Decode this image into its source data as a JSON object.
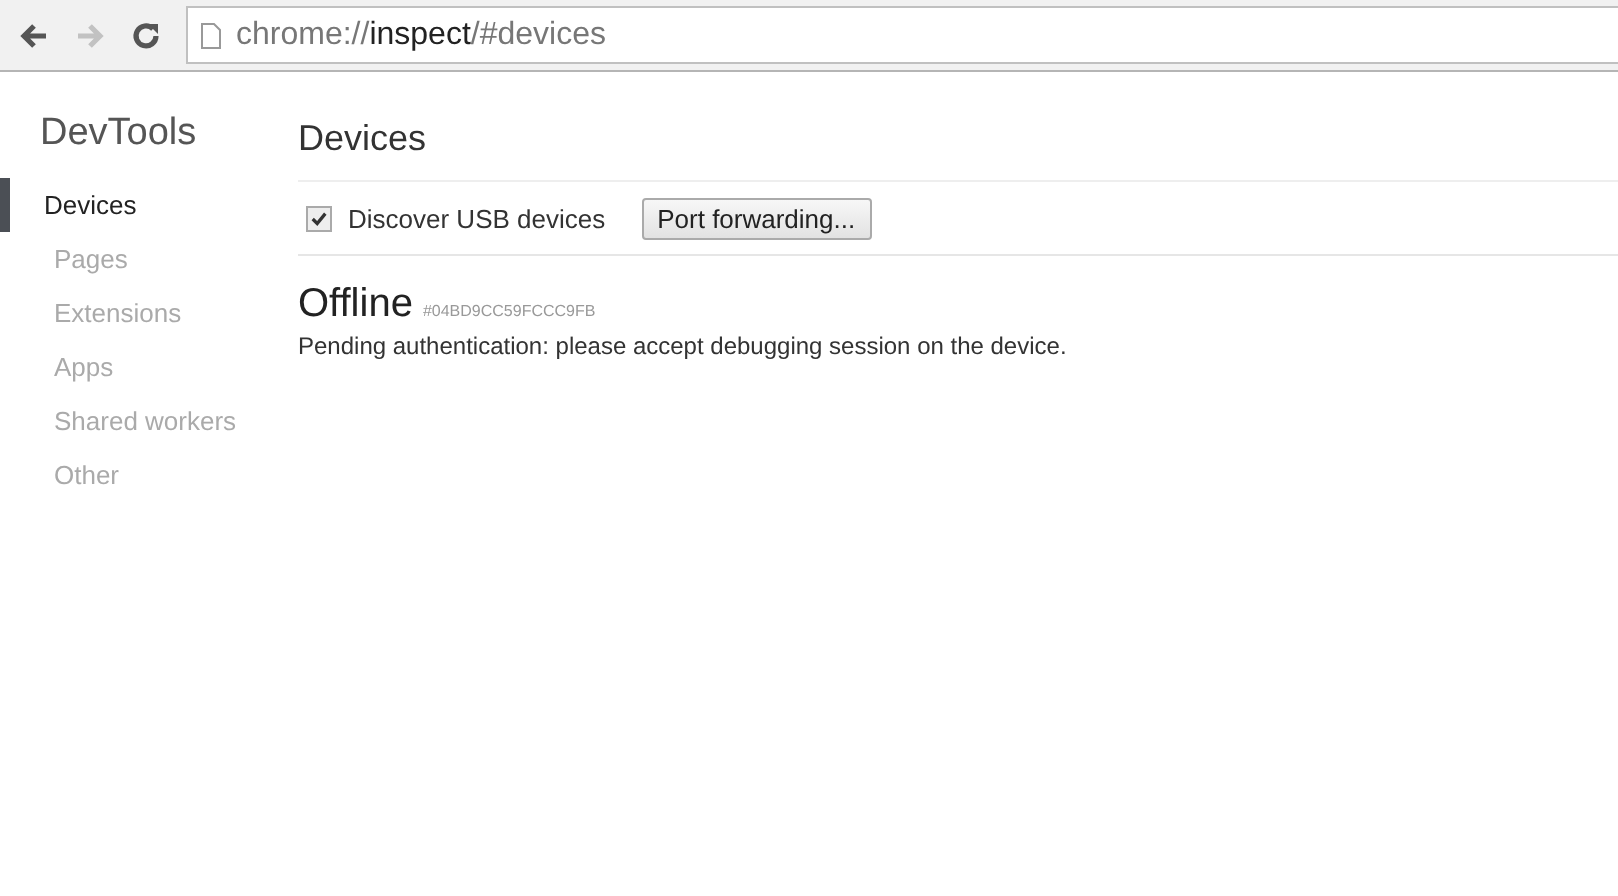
{
  "toolbar": {
    "back_disabled": false,
    "forward_disabled": true,
    "url": {
      "scheme": "chrome://",
      "host": "inspect",
      "path": "/#devices"
    }
  },
  "sidebar": {
    "title": "DevTools",
    "items": [
      {
        "label": "Devices",
        "selected": true
      },
      {
        "label": "Pages",
        "selected": false
      },
      {
        "label": "Extensions",
        "selected": false
      },
      {
        "label": "Apps",
        "selected": false
      },
      {
        "label": "Shared workers",
        "selected": false
      },
      {
        "label": "Other",
        "selected": false
      }
    ]
  },
  "main": {
    "title": "Devices",
    "discover_usb": {
      "label": "Discover USB devices",
      "checked": true
    },
    "port_forwarding_button": "Port forwarding...",
    "device": {
      "status": "Offline",
      "serial": "#04BD9CC59FCCC9FB",
      "message": "Pending authentication: please accept debugging session on the device."
    }
  }
}
